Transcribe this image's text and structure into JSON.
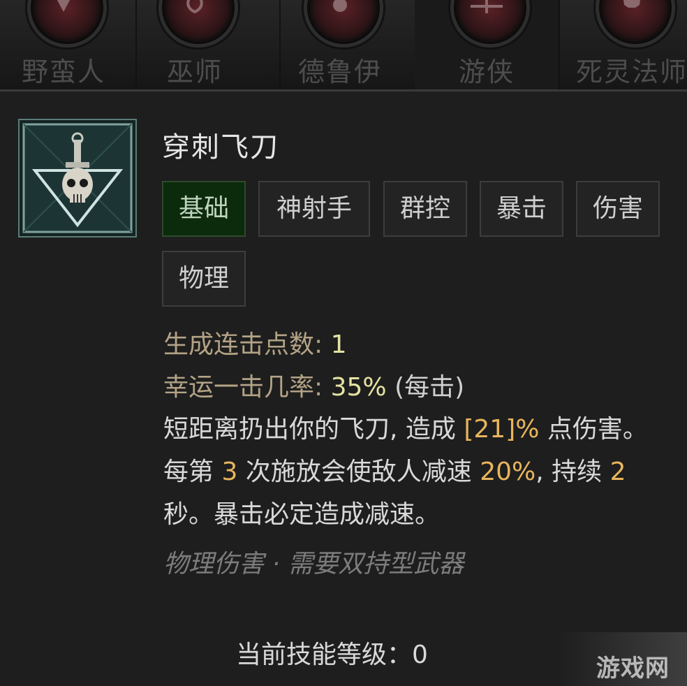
{
  "class_tabs": [
    {
      "label": "野蛮人",
      "emblem": "barbarian-emblem"
    },
    {
      "label": "巫师",
      "emblem": "sorcerer-emblem"
    },
    {
      "label": "德鲁伊",
      "emblem": "druid-emblem"
    },
    {
      "label": "游侠",
      "emblem": "rogue-emblem",
      "active": true
    },
    {
      "label": "死灵法师",
      "emblem": "necromancer-emblem"
    }
  ],
  "skill": {
    "name": "穿刺飞刀",
    "icon": "dagger-skull-icon",
    "tags": [
      "基础",
      "神射手",
      "群控",
      "暴击",
      "伤害",
      "物理"
    ],
    "active_tag": "基础",
    "stats": {
      "combo_label": "生成连击点数:",
      "combo_value": "1",
      "lucky_label": "幸运一击几率:",
      "lucky_value": "35%",
      "lucky_note": "(每击)"
    },
    "description": {
      "p1": "短距离扔出你的飞刀, 造成 ",
      "v1": "[21]%",
      "p2": " 点伤害。每第 ",
      "v2": "3",
      "p3": " 次施放会使敌人减速 ",
      "v3": "20%",
      "p4": ", 持续 ",
      "v4": "2",
      "p5": " 秒。暴击必定造成减速。"
    },
    "footer": "物理伤害 · 需要双持型武器",
    "level_label": "当前技能等级：0"
  },
  "watermark": "游戏网",
  "colors": {
    "background": "#1e1e1e",
    "highlight": "#e8b55d",
    "stat_label": "#b3a386",
    "stat_value": "#e5e2a3",
    "active_tag": "#0c2a0c"
  }
}
